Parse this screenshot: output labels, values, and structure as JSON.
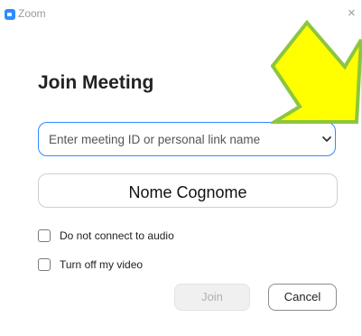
{
  "window": {
    "title": "Zoom",
    "close_glyph": "×"
  },
  "dialog": {
    "heading": "Join Meeting",
    "meeting_id": {
      "placeholder": "Enter meeting ID or personal link name",
      "value": ""
    },
    "name_field": {
      "value": "Nome  Cognome"
    },
    "options": [
      {
        "label": "Do not connect to audio",
        "checked": false
      },
      {
        "label": "Turn off my video",
        "checked": false
      }
    ],
    "buttons": {
      "join_label": "Join",
      "cancel_label": "Cancel"
    }
  },
  "annotation": {
    "type": "arrow",
    "fill_color": "#ffff00",
    "stroke_color": "#8cc63f"
  },
  "colors": {
    "accent": "#2d8cff"
  }
}
